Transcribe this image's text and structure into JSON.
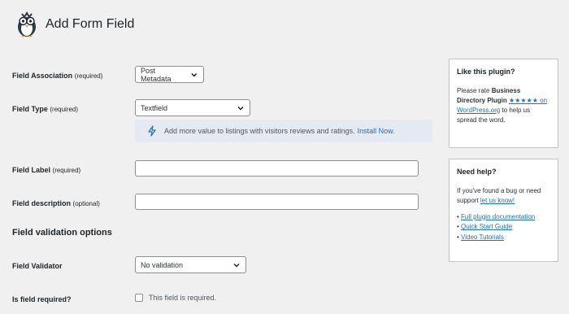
{
  "header": {
    "title": "Add Form Field"
  },
  "form": {
    "field_association": {
      "label": "Field Association",
      "req": "(required)",
      "value": "Post Metadata"
    },
    "field_type": {
      "label": "Field Type",
      "req": "(required)",
      "value": "Textfield"
    },
    "promo": {
      "text": "Add more value to listings with visitors reviews and ratings.",
      "link": "Install Now."
    },
    "field_label": {
      "label": "Field Label",
      "req": "(required)",
      "value": ""
    },
    "field_description": {
      "label": "Field description",
      "req": "(optional)",
      "value": ""
    },
    "validation_section": {
      "title": "Field validation options"
    },
    "field_validator": {
      "label": "Field Validator",
      "value": "No validation"
    },
    "is_required": {
      "label": "Is field required?",
      "checkbox_label": "This field is required.",
      "checked": false
    }
  },
  "sidebar": {
    "like": {
      "title": "Like this plugin?",
      "text_before": "Please rate ",
      "plugin_name": "Business Directory Plugin",
      "stars": "★★★★★",
      "link_text": "on WordPress.org",
      "text_after": " to help us spread the word."
    },
    "help": {
      "title": "Need help?",
      "text_before": "If you've found a bug or need support ",
      "link_text": "let us know!",
      "links": [
        "Full plugin documentation",
        "Quick Start Guide",
        "Video Tutorials"
      ],
      "bullet": "•"
    }
  }
}
